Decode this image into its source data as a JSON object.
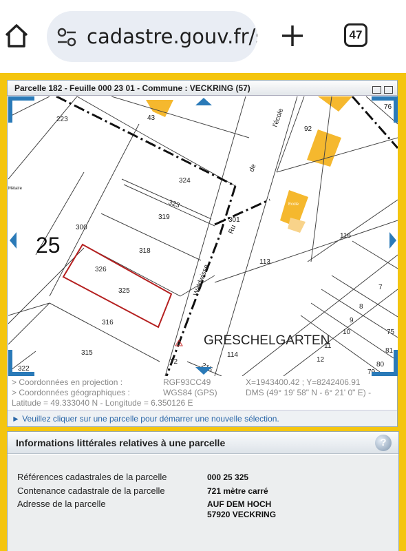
{
  "browser": {
    "url": "cadastre.gouv.fr/s",
    "tab_count": "47",
    "icons": [
      "home-icon",
      "site-settings-icon",
      "new-tab-icon",
      "tab-switcher-icon"
    ]
  },
  "panel": {
    "title": "Parcelle 182 - Feuille 000 23 01 - Commune : VECKRING (57)",
    "map_labels": {
      "section": "25",
      "place": "GRESCHELGARTEN",
      "street_waldwisse": "Waldwisse",
      "street_ecole": "l'école",
      "street_de": "de",
      "street_ru": "Ru",
      "small_left": "Métaire",
      "ecole": "Ecole",
      "parcels": [
        "223",
        "43",
        "76",
        "92",
        "324",
        "323",
        "319",
        "301",
        "300",
        "318",
        "326",
        "325",
        "316",
        "315",
        "322",
        "113",
        "116",
        "7",
        "8",
        "9",
        "10",
        "11",
        "12",
        "114",
        "72",
        "80",
        "79",
        "75",
        "81",
        "215"
      ]
    },
    "coords": {
      "proj_label": "> Coordonnées en projection :",
      "proj_system": "RGF93CC49",
      "proj_value": "X=1943400.42 ; Y=8242406.91",
      "geo_label": "> Coordonnées géographiques :",
      "geo_system": "WGS84 (GPS)",
      "geo_value": "DMS (49° 19' 58\" N - 6° 21' 0\" E) -",
      "latlon": "Latitude = 49.333040 N - Longitude = 6.350126 E"
    },
    "instruction": "► Veuillez cliquer sur une parcelle pour démarrer une nouvelle sélection."
  },
  "info": {
    "title": "Informations littérales relatives à une parcelle",
    "help": "?",
    "rows": [
      {
        "label": "Références cadastrales de la parcelle",
        "value": "000 25 325"
      },
      {
        "label": "Contenance cadastrale de la parcelle",
        "value": "721 mètre carré"
      },
      {
        "label": "Adresse de la parcelle",
        "value": "AUF DEM HOCH",
        "value2": "57920 VECKRING"
      }
    ]
  },
  "colors": {
    "frame": "#f4c50f",
    "accent": "#2a7ab8",
    "selection": "#b52020",
    "building": "#f5b82e"
  }
}
